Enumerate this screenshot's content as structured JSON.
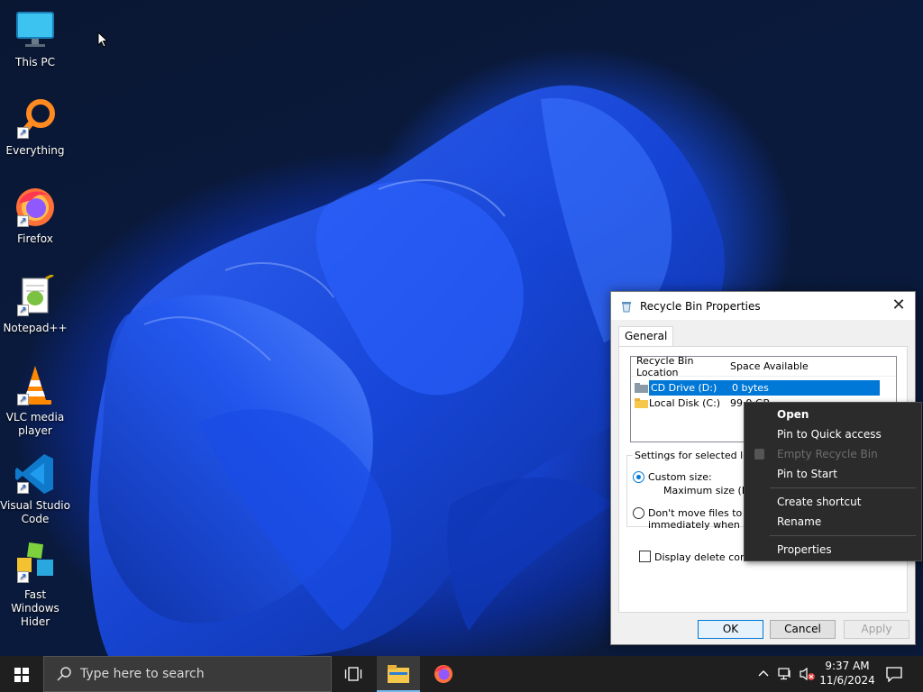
{
  "desktop": {
    "icons": [
      {
        "label": "This PC"
      },
      {
        "label": "Everything"
      },
      {
        "label": "Firefox"
      },
      {
        "label": "Notepad++"
      },
      {
        "label": "VLC media player"
      },
      {
        "label": "Visual Studio Code"
      },
      {
        "label": "Fast Windows Hider"
      }
    ]
  },
  "dialog": {
    "title": "Recycle Bin Properties",
    "close_glyph": "✕",
    "tab_general": "General",
    "list": {
      "col_location": "Recycle Bin Location",
      "col_space": "Space Available",
      "rows": [
        {
          "location": "CD Drive (D:)",
          "space": "0 bytes"
        },
        {
          "location": "Local Disk (C:)",
          "space": "99.9 GB"
        }
      ]
    },
    "group_label": "Settings for selected loca",
    "custom_size_label": "Custom size:",
    "max_size_label": "Maximum size (MB",
    "dont_move_line1": "Don't move files to th",
    "dont_move_line2": "immediately when de",
    "display_confirm_label": "Display delete confirm",
    "ok_label": "OK",
    "cancel_label": "Cancel",
    "apply_label": "Apply"
  },
  "context_menu": {
    "open": "Open",
    "pin_quick_access": "Pin to Quick access",
    "empty_recycle_bin": "Empty Recycle Bin",
    "pin_start": "Pin to Start",
    "create_shortcut": "Create shortcut",
    "rename": "Rename",
    "properties": "Properties"
  },
  "taskbar": {
    "search_placeholder": "Type here to search",
    "time": "9:37 AM",
    "date": "11/6/2024"
  },
  "colors": {
    "accent": "#0078d7",
    "taskbar_bg": "#1f1f1f",
    "menu_bg": "#2b2b2b"
  }
}
